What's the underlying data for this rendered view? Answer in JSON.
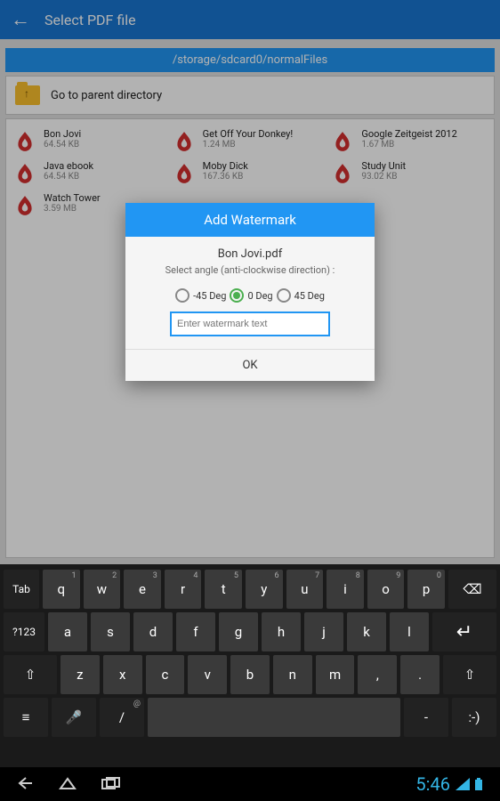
{
  "header": {
    "title": "Select PDF file",
    "path": "/storage/sdcard0/normalFiles",
    "parent_dir": "Go to parent directory"
  },
  "files": [
    {
      "name": "Bon Jovi",
      "size": "64.54 KB"
    },
    {
      "name": "Get Off Your Donkey!",
      "size": "1.24 MB"
    },
    {
      "name": "Google Zeitgeist 2012",
      "size": "1.67 MB"
    },
    {
      "name": "Java ebook",
      "size": "64.54 KB"
    },
    {
      "name": "Moby Dick",
      "size": "167.36 KB"
    },
    {
      "name": "Study Unit",
      "size": "93.02 KB"
    },
    {
      "name": "Watch Tower",
      "size": "3.59 MB"
    }
  ],
  "dialog": {
    "title": "Add Watermark",
    "filename": "Bon Jovi.pdf",
    "hint": "Select angle (anti-clockwise direction) :",
    "opt1": "-45 Deg",
    "opt2": "0 Deg",
    "opt3": "45 Deg",
    "placeholder": "Enter watermark text",
    "ok": "OK"
  },
  "keyboard": {
    "row1_first": "Tab",
    "row1": [
      "q",
      "w",
      "e",
      "r",
      "t",
      "y",
      "u",
      "i",
      "o",
      "p"
    ],
    "row2_first": "?123",
    "row2": [
      "a",
      "s",
      "d",
      "f",
      "g",
      "h",
      "j",
      "k",
      "l"
    ],
    "row3": [
      "z",
      "x",
      "c",
      "v",
      "b",
      "n",
      "m",
      ",",
      "."
    ],
    "row4_mic": "🎤",
    "row4_slash": "/",
    "row4_slash_sup": "@",
    "row4_dash": "-",
    "row4_smile": ":-)",
    "backspace": "⌫",
    "enter": "↵",
    "shift": "⇧",
    "settings": "⚙",
    "keys_sup": [
      "1",
      "2",
      "3",
      "4",
      "5",
      "6",
      "7",
      "8",
      "9",
      "0"
    ]
  },
  "navbar": {
    "back": "◁",
    "home": "◯",
    "recent": "▭",
    "time": "5:46",
    "wifi": "📶",
    "battery": "▮"
  }
}
